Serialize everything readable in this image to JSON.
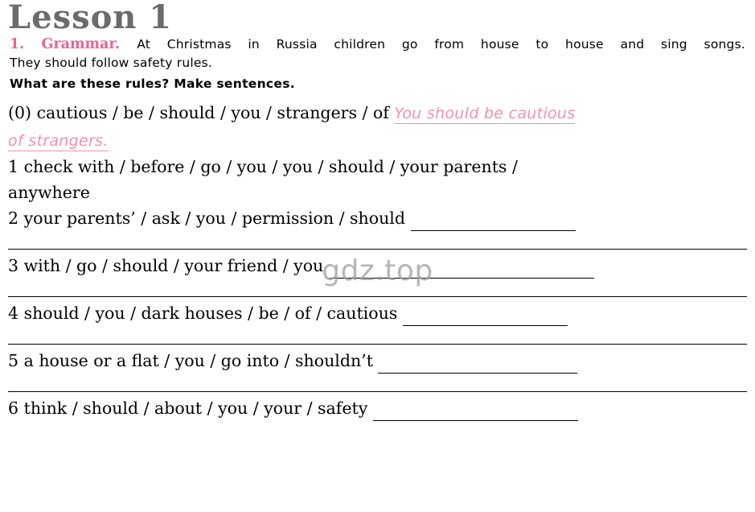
{
  "page": {
    "title": "Lesson 1",
    "watermark": "gdz.top"
  },
  "task": {
    "number": "1.",
    "label": "Grammar.",
    "intro_line1": "At Christmas in Russia children go from house to house and sing songs.",
    "intro_line2": "They should follow safety rules.",
    "instruction": "What are these rules? Make sentences."
  },
  "exercises": [
    {
      "number": "(0)",
      "prompt": "cautious / be / should / you / strangers / of",
      "answer_line1": "You should be cautious",
      "answer_line2": "of strangers."
    },
    {
      "number": "1",
      "prompt": "check with / before / go / you / you / should / your parents /",
      "prompt_cont": "anywhere"
    },
    {
      "number": "2",
      "prompt": "your parents’ / ask / you / permission / should"
    },
    {
      "number": "3",
      "prompt": "with / go / should / your friend / you"
    },
    {
      "number": "4",
      "prompt": "should / you / dark houses / be / of / cautious"
    },
    {
      "number": "5",
      "prompt": "a house or a flat / you / go into / shouldn’t"
    },
    {
      "number": "6",
      "prompt": "think / should / about / you / your / safety"
    }
  ],
  "colors": {
    "accent_pink": "#f06292",
    "handwriting_pink": "#f48fb1",
    "title_gray": "#6b6b6b"
  }
}
